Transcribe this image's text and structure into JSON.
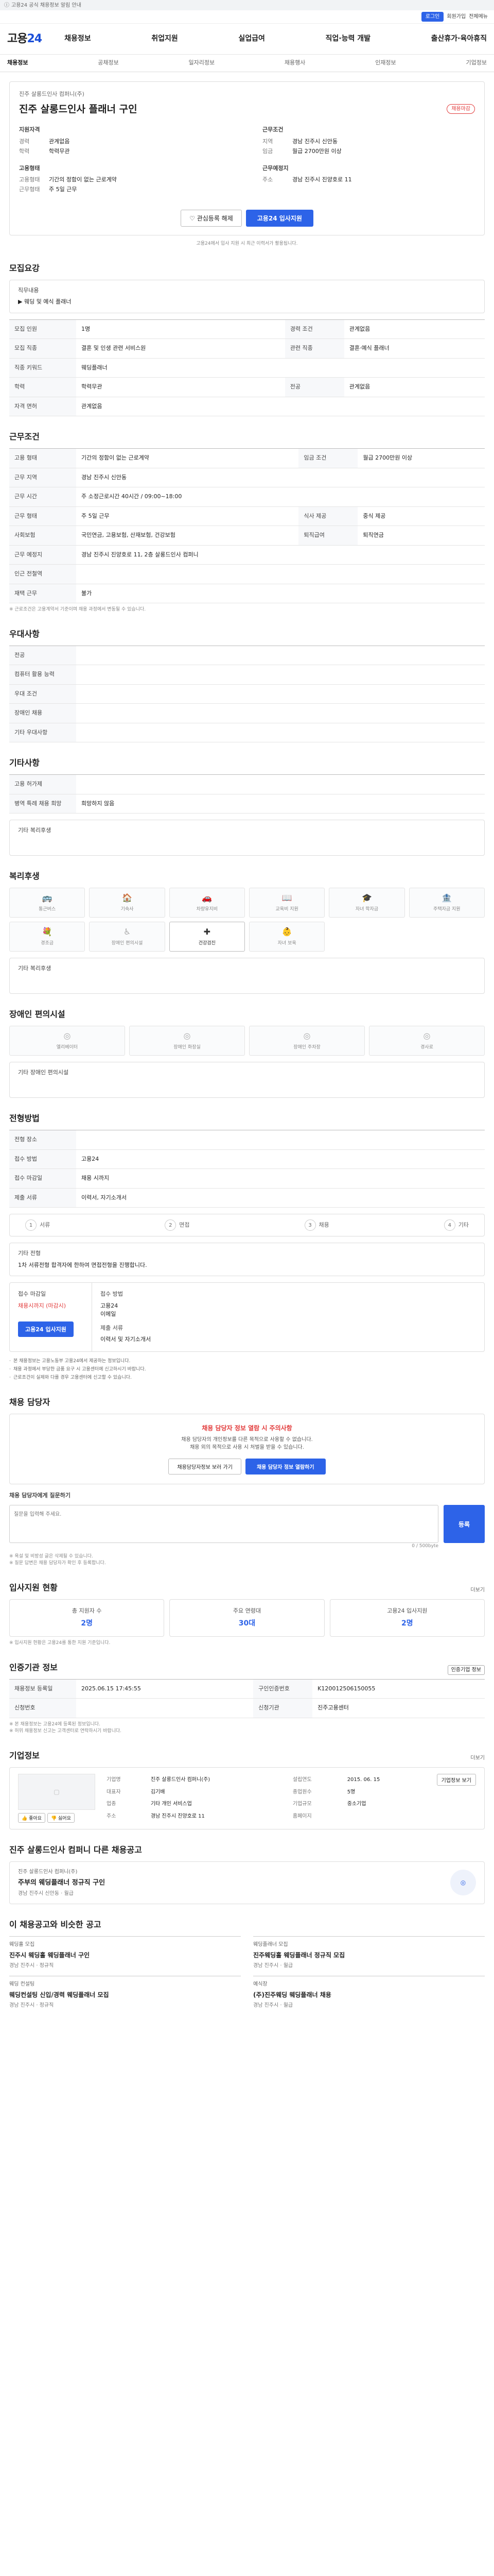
{
  "topnotice": "고용24 공식 채용정보 알림 안내",
  "topbar": {
    "items": [
      "로그인",
      "회원가입",
      "전체메뉴"
    ]
  },
  "logo": {
    "main": "고용",
    "sub": "24"
  },
  "gnb": [
    "채용정보",
    "취업지원",
    "실업급여",
    "직업·능력 개발",
    "출산휴가·육아휴직"
  ],
  "subnav": [
    "채용정보",
    "공채정보",
    "일자리정보",
    "채용행사",
    "인재정보",
    "기업정보"
  ],
  "job": {
    "company": "진주 살롱드인사 컴퍼니(주)",
    "title": "진주 살롱드인사 플래너 구인",
    "badge": "채용마감",
    "groups": {
      "qual": {
        "title": "지원자격",
        "rows": [
          [
            "경력",
            "관계없음"
          ],
          [
            "학력",
            "학력무관"
          ]
        ]
      },
      "work": {
        "title": "근무조건",
        "rows": [
          [
            "지역",
            "경남 진주시 신안동"
          ],
          [
            "임금",
            "월급 2700만원 이상"
          ]
        ]
      },
      "type": {
        "title": "고용형태",
        "rows": [
          [
            "고용형태",
            "기간의 정함이 없는 근로계약"
          ],
          [
            "근무형태",
            "주 5일 근무"
          ]
        ]
      },
      "loc": {
        "title": "근무예정지",
        "rows": [
          [
            "주소",
            "경남 진주시 진양호로 11"
          ]
        ]
      }
    },
    "btn_fav": "관심등록 해제",
    "btn_apply": "고용24 입사지원",
    "notice": "고용24에서 입사 지원 시 최근 이력서가 활용됩니다."
  },
  "recruit": {
    "title": "모집요강",
    "label": "직무내용",
    "value": "▶ 웨딩 및 예식 플래너"
  },
  "recruit_tbl": [
    [
      "모집 인원",
      "1명",
      "경력 조건",
      "관계없음"
    ],
    [
      "모집 직종",
      "결혼 및 인생 관련 서비스원",
      "관련 직종",
      "결혼·예식 플래너"
    ],
    [
      "직종 키워드",
      "웨딩플래너",
      "",
      ""
    ],
    [
      "학력",
      "학력무관",
      "전공",
      "관계없음"
    ],
    [
      "자격 면허",
      "관계없음",
      "",
      ""
    ]
  ],
  "work": {
    "title": "근무조건"
  },
  "work_tbl": [
    [
      "고용 형태",
      "기간의 정함이 없는 근로계약",
      "임금 조건",
      "월급 2700만원 이상"
    ],
    [
      "근무 지역",
      "경남 진주시 신안동",
      "",
      ""
    ],
    [
      "근무 시간",
      "주 소정근로시간 40시간 / 09:00~18:00",
      "",
      ""
    ],
    [
      "근무 형태",
      "주 5일 근무",
      "식사 제공",
      "중식 제공"
    ],
    [
      "사회보험",
      "국민연금, 고용보험, 산재보험, 건강보험",
      "퇴직급여",
      "퇴직연금"
    ],
    [
      "근무 예정지",
      "경남 진주시 진양호로 11, 2층 살롱드인사 컴퍼니",
      "",
      ""
    ],
    [
      "인근 전철역",
      "",
      "",
      ""
    ],
    [
      "재택 근무",
      "불가",
      "",
      ""
    ]
  ],
  "work_note": "※ 근로조건은 고용계약서 기준이며 채용 과정에서 변동될 수 있습니다.",
  "prefer": {
    "title": "우대사항"
  },
  "prefer_tbl": [
    [
      "전공",
      ""
    ],
    [
      "컴퓨터 활용 능력",
      ""
    ],
    [
      "우대 조건",
      ""
    ],
    [
      "장애인 채용",
      ""
    ],
    [
      "기타 우대사항",
      ""
    ]
  ],
  "etc": {
    "title": "기타사항"
  },
  "etc_tbl": [
    [
      "고용 허가제",
      ""
    ],
    [
      "병역 특례 채용 희망",
      "희망하지 않음"
    ]
  ],
  "etc_box": {
    "label": "기타 복리후생",
    "value": ""
  },
  "welfare": {
    "title": "복리후생",
    "items": [
      "통근버스",
      "기숙사",
      "차량유지비",
      "교육비 지원",
      "자녀 학자금",
      "주택자금 지원",
      "경조금",
      "장애인 편의시설",
      "건강검진",
      "자녀 보육"
    ],
    "active": "건강검진"
  },
  "welfare_box": {
    "label": "기타 복리후생",
    "value": ""
  },
  "disabled": {
    "title": "장애인 편의시설",
    "items": [
      "엘리베이터",
      "장애인 화장실",
      "장애인 주차장",
      "경사로"
    ]
  },
  "disabled_box": {
    "label": "기타 장애인 편의시설",
    "value": ""
  },
  "procedure": {
    "title": "전형방법"
  },
  "proc_tbl": [
    [
      "전형 장소",
      ""
    ],
    [
      "접수 방법",
      "고용24"
    ],
    [
      "접수 마감일",
      "채용 시까지"
    ],
    [
      "제출 서류",
      "이력서, 자기소개서"
    ]
  ],
  "proc_tbl2": [
    [
      "",
      ""
    ],
    [
      "",
      ""
    ],
    [
      "",
      ""
    ],
    [
      "",
      ""
    ]
  ],
  "steps": [
    "서류",
    "면접",
    "채용",
    "기타"
  ],
  "proc_note": {
    "label": "기타 전형",
    "value": "1차 서류전형 합격자에 한하여 면접전형을 진행합니다."
  },
  "apply": {
    "left_label": "접수 마감일",
    "left_value": "채용시까지 (마감시)",
    "left_btn": "고용24 입사지원",
    "right_label": "접수 방법",
    "right_items": [
      "고용24",
      "이메일"
    ],
    "right_label2": "제출 서류",
    "right_value2": "이력서 및 자기소개서"
  },
  "cautions": [
    "본 채용정보는 고용노동부 고용24에서 제공하는 정보입니다.",
    "채용 과정에서 부당한 금품 요구 시 고용센터에 신고하시기 바랍니다.",
    "근로조건이 실제와 다를 경우 고용센터에 신고할 수 있습니다."
  ],
  "contact": {
    "title": "채용 담당자",
    "warn": "채용 담당자 정보 열람 시 주의사항",
    "desc": "채용 담당자의 개인정보를 다른 목적으로 사용할 수 없습니다.",
    "desc2": "채용 외의 목적으로 사용 시 처벌을 받을 수 있습니다.",
    "btn1": "채용담당자정보 보러 가기",
    "btn2": "채용 담당자 정보 열람하기"
  },
  "qa": {
    "title": "채용 담당자에게 질문하기",
    "placeholder": "질문을 입력해 주세요.",
    "reg": "등록",
    "counter": "0 / 500byte",
    "note1": "※ 욕설 및 비방성 글은 삭제될 수 있습니다.",
    "note2": "※ 질문 답변은 채용 담당자가 확인 후 등록합니다."
  },
  "stats": {
    "title": "입사지원 현황",
    "more": "더보기",
    "items": [
      {
        "t": "총 지원자 수",
        "n": "2명"
      },
      {
        "t": "주요 연령대",
        "n": "30대"
      },
      {
        "t": "고용24 입사지원",
        "n": "2명"
      }
    ],
    "note": "※ 입사지원 현황은 고용24를 통한 지원 기준입니다."
  },
  "info": {
    "title": "인증기관 정보",
    "more": "인증기업 정보",
    "tbl": [
      [
        "채용정보 등록일",
        "2025.06.15 17:45:55",
        "구인인증번호",
        "K120012506150055"
      ],
      [
        "신청번호",
        "",
        "신청기관",
        "진주고용센터"
      ]
    ],
    "note1": "※ 본 채용정보는 고용24에 등록된 정보입니다.",
    "note2": "※ 허위 채용정보 신고는 고객센터로 연락하시기 바랍니다."
  },
  "company": {
    "title": "기업정보",
    "more": "더보기",
    "rows": [
      [
        "기업명",
        "진주 살롱드인사 컴퍼니(주)",
        "설립연도",
        "2015. 06. 15"
      ],
      [
        "대표자",
        "김기배",
        "종업원수",
        "5명"
      ],
      [
        "업종",
        "기타 개인 서비스업",
        "기업규모",
        "중소기업"
      ],
      [
        "주소",
        "경남 진주시 진양호로 11",
        "홈페이지",
        ""
      ]
    ],
    "btn": "기업정보 보기",
    "like": "좋아요",
    "hate": "싫어요"
  },
  "reco1": {
    "title": "진주 살롱드인사 컴퍼니 다른 채용공고",
    "item": {
      "co": "진주 살롱드인사 컴퍼니(주)",
      "tt": "주부의 웨딩플래너 정규직 구인",
      "ct": "경남 진주시 신안동 · 월급"
    }
  },
  "reco2": {
    "title": "이 채용공고와 비슷한 공고",
    "items": [
      {
        "co": "웨딩홀 모집",
        "tt": "진주시 웨딩홀 웨딩플래너 구인",
        "ct": "경남 진주시 · 정규직"
      },
      {
        "co": "웨딩플래너 모집",
        "tt": "진주웨딩홀 웨딩플래너 정규직 모집",
        "ct": "경남 진주시 · 월급"
      },
      {
        "co": "웨딩 컨설팅",
        "tt": "웨딩컨설팅 신입/경력 웨딩플래너 모집",
        "ct": "경남 진주시 · 정규직"
      },
      {
        "co": "예식장",
        "tt": "(주)진주웨딩 웨딩플래너 채용",
        "ct": "경남 진주시 · 월급"
      }
    ]
  }
}
